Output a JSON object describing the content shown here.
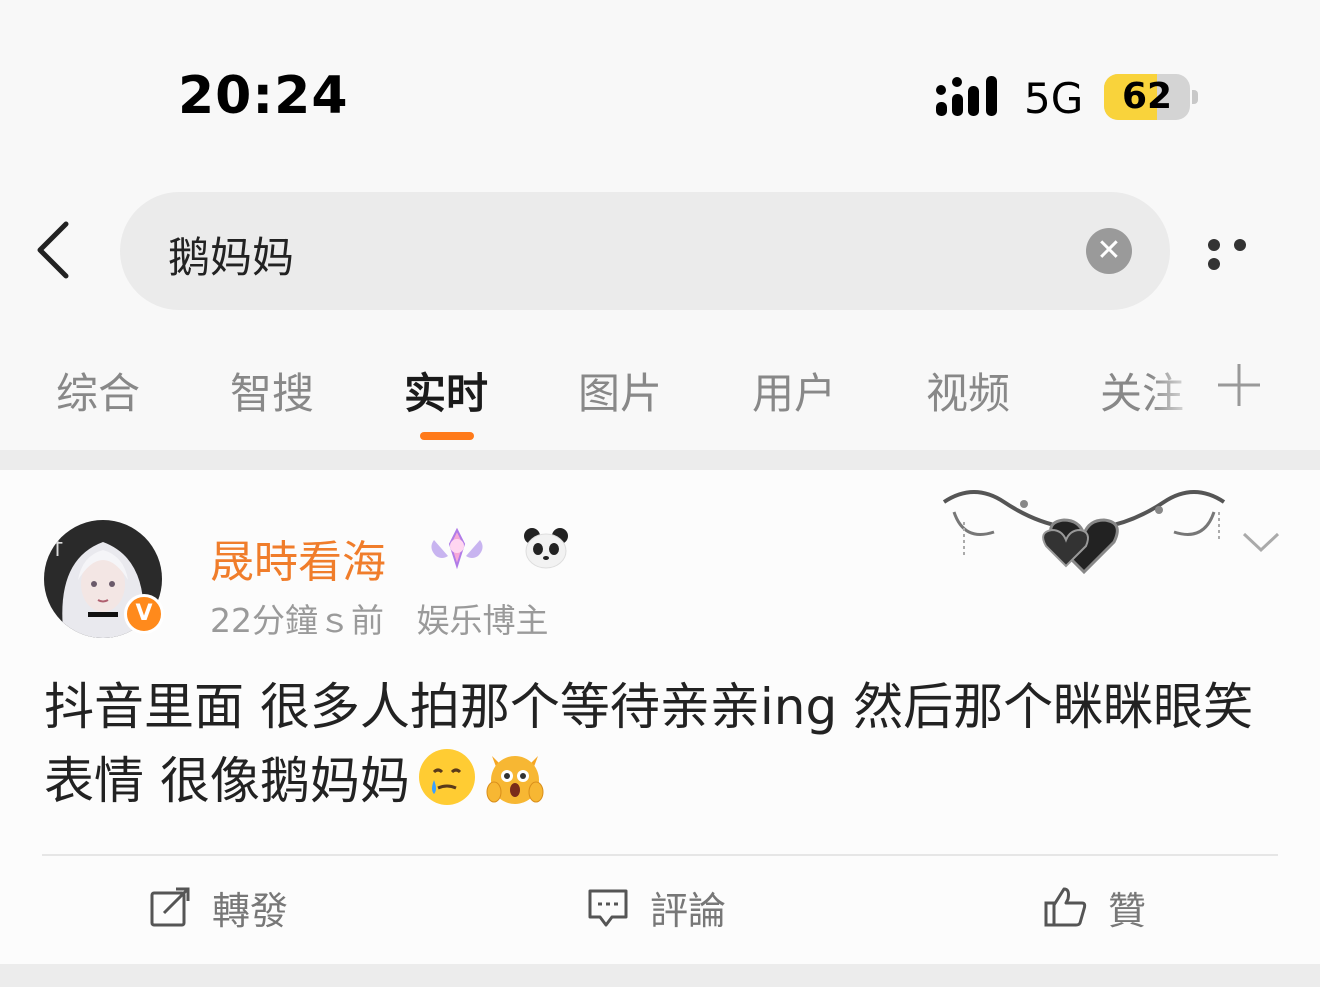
{
  "status_bar": {
    "time": "20:24",
    "network": "5G",
    "battery_level": "62",
    "battery_fraction": 0.62
  },
  "search": {
    "query": "鹅妈妈",
    "clear_icon": "close-circle-icon",
    "back_icon": "chevron-left-icon",
    "more_icon": "more-dots-icon"
  },
  "tabs": [
    {
      "label": "综合"
    },
    {
      "label": "智搜"
    },
    {
      "label": "实时"
    },
    {
      "label": "图片"
    },
    {
      "label": "用户"
    },
    {
      "label": "视频"
    },
    {
      "label": "关注"
    }
  ],
  "active_tab": "实时",
  "accent_color": "#ff7a1a",
  "post": {
    "username": "晟時看海",
    "username_color": "#f07d2b",
    "verified_badge": "V",
    "time_ago": "22分鐘ｓ前",
    "user_tag": "娱乐博主",
    "text": "抖音里面 很多人拍那个等待亲亲ing 然后那个眯眯眼笑表情 很像鹅妈妈",
    "emojis": [
      "face-holding-back-tears-emoji",
      "weary-cat-emoji"
    ],
    "actions": {
      "repost": "轉發",
      "comment": "評論",
      "like": "贊"
    }
  }
}
